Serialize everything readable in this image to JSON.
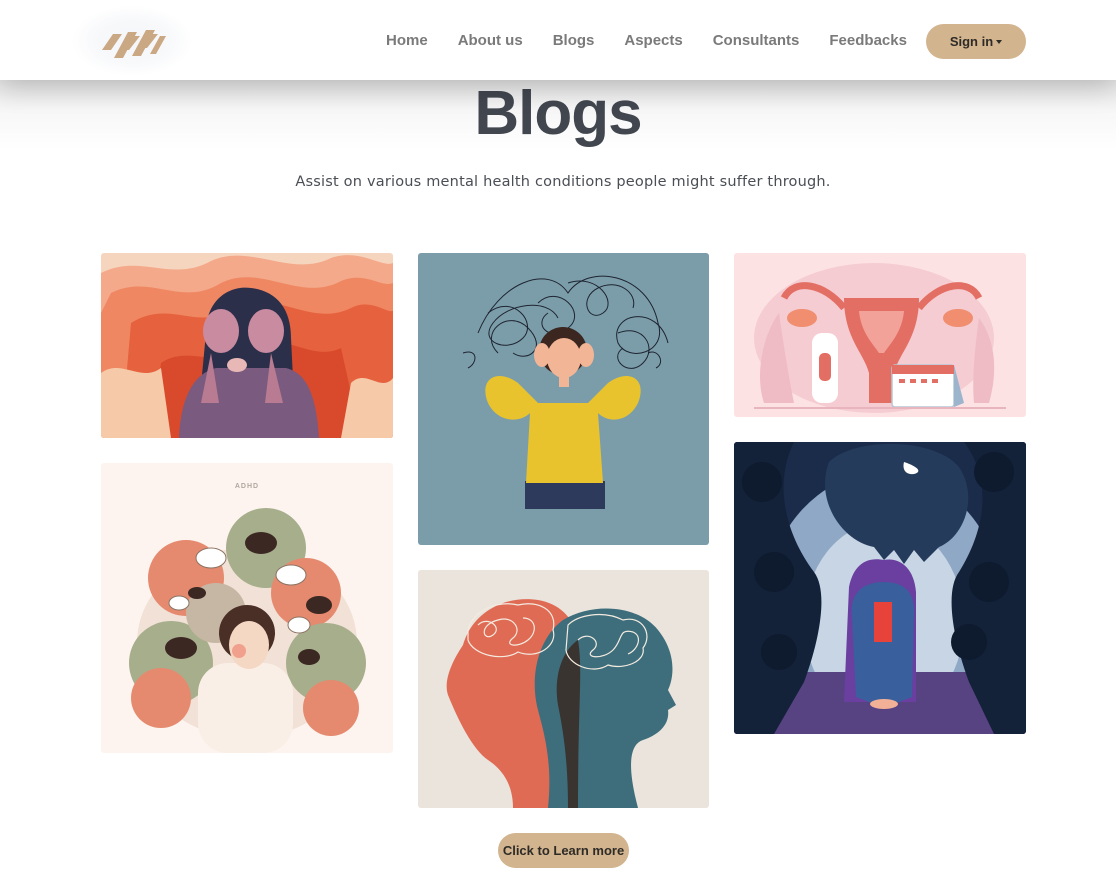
{
  "nav": {
    "items": [
      {
        "label": "Home"
      },
      {
        "label": "About us"
      },
      {
        "label": "Blogs"
      },
      {
        "label": "Aspects"
      },
      {
        "label": "Consultants"
      },
      {
        "label": "Feedbacks"
      }
    ],
    "signin_label": "Sign in"
  },
  "header": {
    "title": "Blogs",
    "subtitle": "Assist on various mental health conditions people might suffer through."
  },
  "cards": [
    {
      "topic": "distressed-woman-illustration"
    },
    {
      "topic": "adhd-illustration",
      "caption": "ADHD"
    },
    {
      "topic": "anxious-woman-scribbles-illustration"
    },
    {
      "topic": "dual-heads-brain-illustration"
    },
    {
      "topic": "menstrual-health-illustration"
    },
    {
      "topic": "shadow-monsters-illustration"
    }
  ],
  "cta": {
    "label": "Click to Learn more"
  },
  "colors": {
    "accent": "#d2b48f",
    "title": "#41464f",
    "nav": "#7a7a7a"
  }
}
